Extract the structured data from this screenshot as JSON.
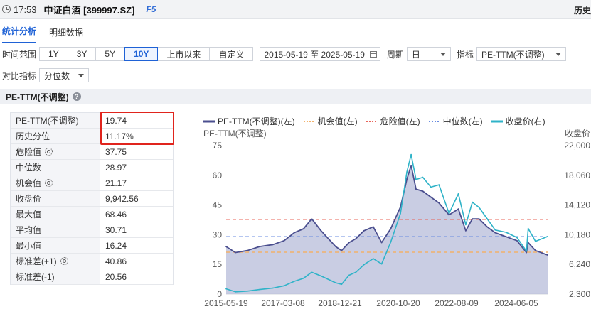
{
  "header": {
    "time": "17:53",
    "title": "中证白酒 [399997.SZ]",
    "fkey": "F5",
    "history": "历史"
  },
  "tabs": [
    {
      "label": "统计分析",
      "active": true
    },
    {
      "label": "明细数据",
      "active": false
    }
  ],
  "controls": {
    "range_label": "时间范围",
    "ranges": [
      "1Y",
      "3Y",
      "5Y",
      "10Y",
      "上市以来",
      "自定义"
    ],
    "active_range": "10Y",
    "date_range": "2015-05-19 至 2025-05-19",
    "period_label": "周期",
    "period_value": "日",
    "indicator_label": "指标",
    "indicator_value": "PE-TTM(不调整)",
    "compare_label": "对比指标",
    "compare_value": "分位数"
  },
  "section": {
    "title": "PE-TTM(不调整)",
    "help_icon": "?"
  },
  "stats": [
    {
      "key": "PE-TTM(不调整)",
      "value": "19.74",
      "gear": false
    },
    {
      "key": "历史分位",
      "value": "11.17%",
      "gear": false
    },
    {
      "key": "危险值",
      "value": "37.75",
      "gear": true
    },
    {
      "key": "中位数",
      "value": "28.97",
      "gear": false
    },
    {
      "key": "机会值",
      "value": "21.17",
      "gear": true
    },
    {
      "key": "收盘价",
      "value": "9,942.56",
      "gear": false
    },
    {
      "key": "最大值",
      "value": "68.46",
      "gear": false
    },
    {
      "key": "平均值",
      "value": "30.71",
      "gear": false
    },
    {
      "key": "最小值",
      "value": "16.24",
      "gear": false
    },
    {
      "key": "标准差(+1)",
      "value": "40.86",
      "gear": true
    },
    {
      "key": "标准差(-1)",
      "value": "20.56",
      "gear": false
    }
  ],
  "legend": [
    {
      "label": "PE-TTM(不调整)(左)",
      "color": "#4b4f8f",
      "style": "solid"
    },
    {
      "label": "机会值(左)",
      "color": "#f3b26b",
      "style": "dotted"
    },
    {
      "label": "危险值(左)",
      "color": "#e8645a",
      "style": "dotted"
    },
    {
      "label": "中位数(左)",
      "color": "#6b8de0",
      "style": "dotted"
    },
    {
      "label": "收盘价(右)",
      "color": "#2fb3c8",
      "style": "solid"
    }
  ],
  "chart_data": {
    "type": "line",
    "left_axis_title": "PE-TTM(不调整)",
    "right_axis_title": "收盘价",
    "left_ticks": [
      "75",
      "60",
      "45",
      "30",
      "15",
      "0"
    ],
    "right_ticks": [
      "22,000",
      "18,060",
      "14,120",
      "10,180",
      "6,240",
      "2,300"
    ],
    "x_ticks": [
      "2015-05-19",
      "2017-03-08",
      "2018-12-21",
      "2020-10-20",
      "2022-08-09",
      "2024-06-05"
    ],
    "ylim_left": [
      0,
      75
    ],
    "ylim_right": [
      2300,
      22000
    ],
    "reference_lines": {
      "opportunity": 21.17,
      "danger": 37.75,
      "median": 28.97
    },
    "series": [
      {
        "name": "PE-TTM(不调整)(左)",
        "x": [
          "2015-05-19",
          "2015-09-01",
          "2016-01-15",
          "2016-06-01",
          "2016-11-01",
          "2017-03-08",
          "2017-07-01",
          "2017-10-15",
          "2018-01-15",
          "2018-05-01",
          "2018-10-15",
          "2018-12-21",
          "2019-03-15",
          "2019-06-01",
          "2019-09-01",
          "2019-12-15",
          "2020-03-20",
          "2020-07-01",
          "2020-10-20",
          "2021-01-01",
          "2021-02-18",
          "2021-04-15",
          "2021-07-01",
          "2021-10-01",
          "2022-01-01",
          "2022-04-25",
          "2022-08-09",
          "2022-11-01",
          "2023-01-15",
          "2023-04-01",
          "2023-07-01",
          "2023-10-01",
          "2024-02-01",
          "2024-06-05",
          "2024-09-20",
          "2024-10-10",
          "2025-01-01",
          "2025-05-19"
        ],
        "values": [
          24,
          21,
          22,
          24,
          25,
          27,
          31,
          33,
          38,
          32,
          24,
          22,
          26,
          28,
          32,
          34,
          26,
          33,
          44,
          58,
          65,
          53,
          52,
          49,
          46,
          40,
          43,
          32,
          38,
          38,
          34,
          31,
          29,
          27,
          21,
          26,
          22,
          19.74
        ]
      },
      {
        "name": "收盘价(右)",
        "x": [
          "2015-05-19",
          "2015-09-01",
          "2016-01-15",
          "2016-06-01",
          "2016-11-01",
          "2017-03-08",
          "2017-07-01",
          "2017-10-15",
          "2018-01-15",
          "2018-05-01",
          "2018-10-15",
          "2018-12-21",
          "2019-03-15",
          "2019-06-01",
          "2019-09-01",
          "2019-12-15",
          "2020-03-20",
          "2020-07-01",
          "2020-10-20",
          "2021-01-01",
          "2021-02-18",
          "2021-04-15",
          "2021-07-01",
          "2021-10-01",
          "2022-01-01",
          "2022-04-25",
          "2022-08-09",
          "2022-11-01",
          "2023-01-15",
          "2023-04-01",
          "2023-07-01",
          "2023-10-01",
          "2024-02-01",
          "2024-06-05",
          "2024-09-20",
          "2024-10-10",
          "2025-01-01",
          "2025-05-19"
        ],
        "values": [
          3000,
          2600,
          2700,
          2900,
          3100,
          3400,
          4000,
          4400,
          5200,
          4700,
          3800,
          3600,
          4800,
          5200,
          6200,
          7000,
          6300,
          9200,
          13000,
          18500,
          20800,
          17500,
          17800,
          16500,
          16800,
          13000,
          15600,
          11500,
          14500,
          13800,
          12300,
          10800,
          10500,
          9800,
          8000,
          11000,
          9300,
          9942.56
        ]
      }
    ]
  }
}
